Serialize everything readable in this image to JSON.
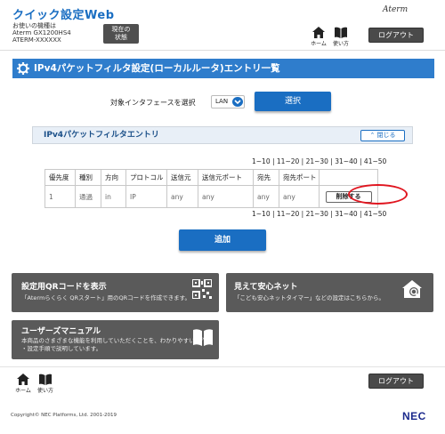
{
  "header": {
    "app_title": "クイック設定Web",
    "device_label": "お使いの機種は",
    "device_model": "Aterm GX1200HS4",
    "device_serial": "ATERM-XXXXXX",
    "status_button": [
      "現在の",
      "状態"
    ],
    "logo": "Aterm",
    "home_label": "ホーム",
    "usage_label": "使い方",
    "logout_label": "ログアウト"
  },
  "page": {
    "title": "IPv4パケットフィルタ設定(ローカルルータ)エントリ一覧",
    "interface_label": "対象インタフェースを選択",
    "interface_value": "LAN",
    "select_button": "選択"
  },
  "entry_section": {
    "title": "IPv4パケットフィルタエントリ",
    "collapse_label": "閉じる",
    "pager": [
      "1~10",
      "11~20",
      "21~30",
      "31~40",
      "41~50"
    ],
    "columns": [
      "優先度",
      "種別",
      "方向",
      "プロトコル",
      "送信元",
      "送信元ポート",
      "宛先",
      "宛先ポート",
      ""
    ],
    "rows": [
      [
        "1",
        "通過",
        "in",
        "IP",
        "any",
        "any",
        "any",
        "any"
      ]
    ],
    "delete_label": "削除する",
    "add_label": "追加"
  },
  "cards": {
    "qr_title": "設定用QRコードを表示",
    "qr_desc": "「Atermらくらく QRスタート」用のQRコードを作成できます。",
    "safe_title": "見えて安心ネット",
    "safe_desc": "「こども安心ネットタイマー」などの設定はこちらから。",
    "manual_title": "ユーザーズマニュアル",
    "manual_desc_1": "本商品のさまざまな機能を利用していただくことを、わかりやすい操作",
    "manual_desc_2": "・設定手順で説明しています。"
  },
  "footer": {
    "home_label": "ホーム",
    "usage_label": "使い方",
    "logout_label": "ログアウト",
    "copyright": "Copyright© NEC Platforms, Ltd. 2001-2019",
    "logo": "NEC"
  },
  "colors": {
    "accent": "#1a6ec2",
    "title_bar": "#2f7dcc",
    "dark_button": "#4a4a4a",
    "card": "#5a5a5a",
    "highlight": "#e0151f"
  }
}
